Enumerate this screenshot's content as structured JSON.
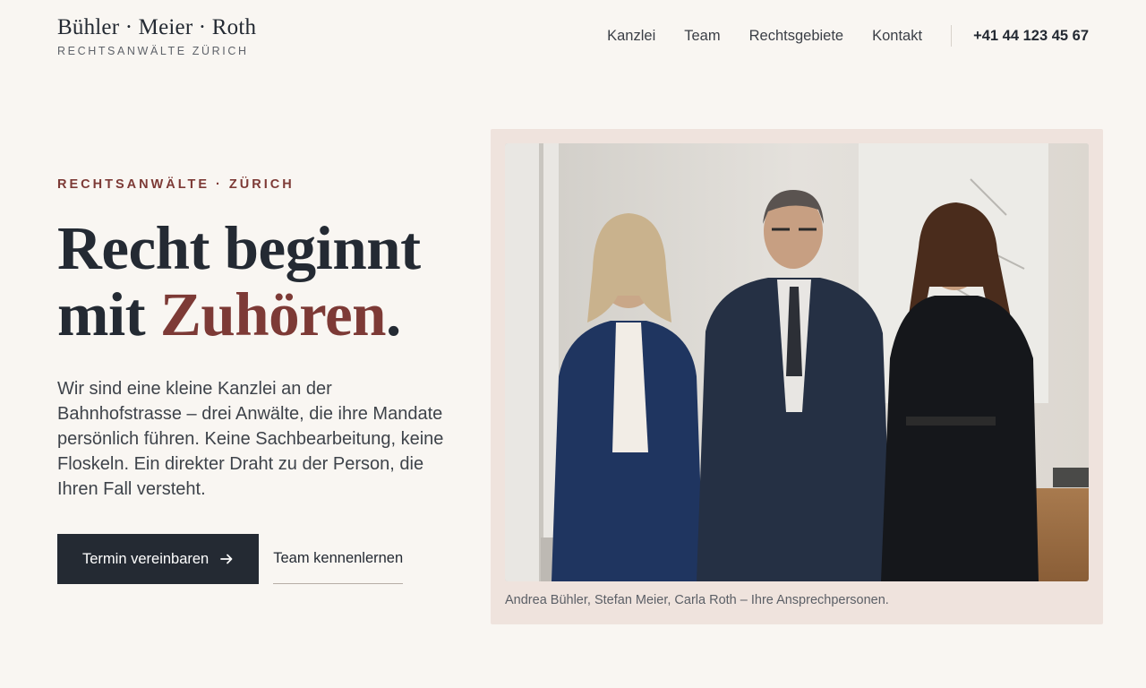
{
  "header": {
    "brand_name": "Bühler · Meier · Roth",
    "brand_sub": "RECHTSANWÄLTE ZÜRICH",
    "nav": [
      {
        "label": "Kanzlei"
      },
      {
        "label": "Team"
      },
      {
        "label": "Rechtsgebiete"
      },
      {
        "label": "Kontakt"
      }
    ],
    "phone": "+41 44 123 45 67"
  },
  "hero": {
    "eyebrow": "RECHTSANWÄLTE · ZÜRICH",
    "headline_line1": "Recht beginnt",
    "headline_line2_prefix": "mit ",
    "headline_accent": "Zuhören",
    "headline_suffix": ".",
    "lead": "Wir sind eine kleine Kanzlei an der Bahnhofstrasse – drei Anwälte, die ihre Mandate persönlich führen. Keine Sachbearbeitung, keine Floskeln. Ein direkter Draht zu der Person, die Ihren Fall versteht.",
    "primary_cta": "Termin vereinbaren",
    "secondary_cta": "Team kennenlernen"
  },
  "photo": {
    "caption": "Andrea Bühler, Stefan Meier, Carla Roth – Ihre Ansprechpersonen."
  },
  "colors": {
    "background": "#f9f6f2",
    "ink": "#242a33",
    "accent": "#7d3a36",
    "card": "#efe3dd"
  },
  "icons": {
    "cta_arrow": "arrow-right-icon"
  }
}
